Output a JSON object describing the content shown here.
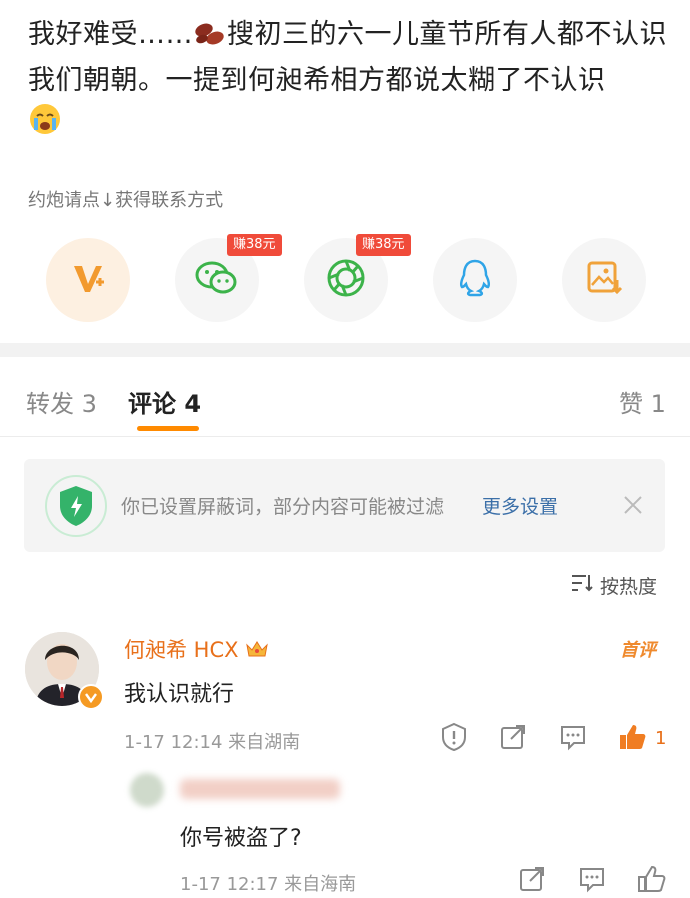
{
  "post": {
    "text_part1": "我好难受……",
    "text_part2": "搜初三的六一儿童节所有人都不认识我们朝朝。一提到何昶希相方都说太糊了不认识",
    "promo_text": "约炮请点↓获得联系方式"
  },
  "share": {
    "badge_wechat": "赚38元",
    "badge_moments": "赚38元"
  },
  "tabs": {
    "repost": "转发 3",
    "comment": "评论 4",
    "like": "赞 1"
  },
  "filter_banner": {
    "text": "你已设置屏蔽词，部分内容可能被过滤",
    "link": "更多设置"
  },
  "sort": {
    "label": "按热度"
  },
  "comments": [
    {
      "name": "何昶希 HCX",
      "badge": "首评",
      "text": "我认识就行",
      "meta": "1-17 12:14  来自湖南",
      "like_count": "1"
    },
    {
      "text": "你号被盗了?",
      "meta": "1-17 12:17  来自海南"
    }
  ],
  "colors": {
    "accent": "#ff8a00",
    "link": "#3b6fa8",
    "badge": "#f04b3a",
    "name": "#e8701a"
  }
}
